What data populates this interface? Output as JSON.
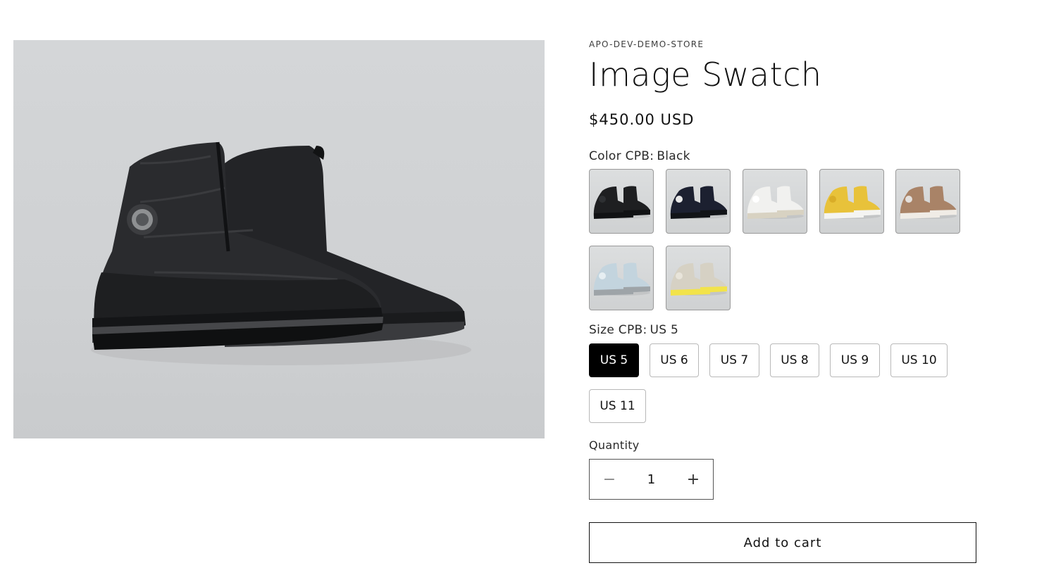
{
  "product": {
    "vendor": "APO-DEV-DEMO-STORE",
    "title": "Image Swatch",
    "price": "$450.00 USD"
  },
  "color": {
    "label": "Color CPB:",
    "selected": "Black",
    "swatches": [
      {
        "name": "Black",
        "body": "#1e1f21",
        "sole": "#111214",
        "accent": "#2e3033"
      },
      {
        "name": "Navy",
        "body": "#1c2030",
        "sole": "#121418",
        "accent": "#e8e8e8"
      },
      {
        "name": "White",
        "body": "#f1f1ef",
        "sole": "#d8d2c2",
        "accent": "#ffffff"
      },
      {
        "name": "Yellow",
        "body": "#e8c23a",
        "sole": "#f4f4f2",
        "accent": "#d9ad28"
      },
      {
        "name": "Tan",
        "body": "#a98367",
        "sole": "#f0ece6",
        "accent": "#e4e0dc"
      },
      {
        "name": "Light Blue",
        "body": "#c3d4de",
        "sole": "#9ea4a8",
        "accent": "#e6eef2"
      },
      {
        "name": "Stone",
        "body": "#d6d1c4",
        "sole": "#f2e34a",
        "accent": "#e8e4da"
      }
    ]
  },
  "size": {
    "label": "Size CPB:",
    "selected": "US 5",
    "options": [
      "US 5",
      "US 6",
      "US 7",
      "US 8",
      "US 9",
      "US 10",
      "US 11"
    ]
  },
  "quantity": {
    "label": "Quantity",
    "value": "1",
    "minus": "−",
    "plus": "+"
  },
  "cart": {
    "label": "Add to cart"
  }
}
